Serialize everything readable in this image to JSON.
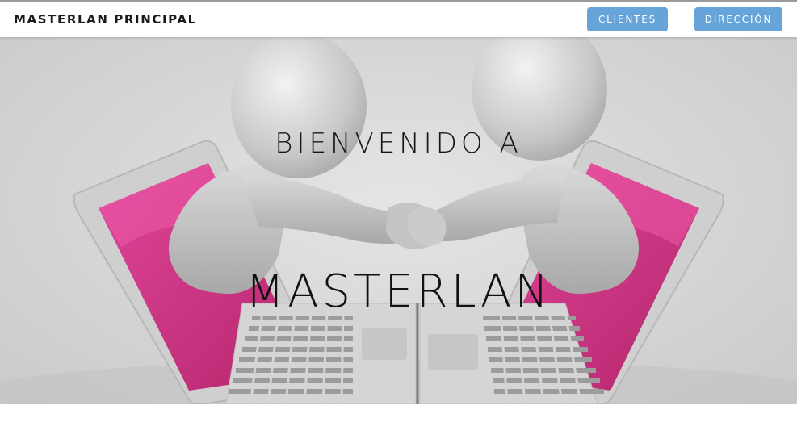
{
  "navbar": {
    "brand": "MASTERLAN PRINCIPAL",
    "buttons": [
      {
        "label": "CLIENTES"
      },
      {
        "label": "DIRECCIÓN"
      }
    ]
  },
  "hero": {
    "line1": "BIENVENIDO A",
    "line2": "MASTERLAN",
    "image": "two-figures-handshake-through-laptops"
  },
  "colors": {
    "button_bg": "#67a4d9",
    "button_text": "#ffffff",
    "screen_magenta": "#d0327f",
    "hero_bg": "#d3d4d5"
  }
}
